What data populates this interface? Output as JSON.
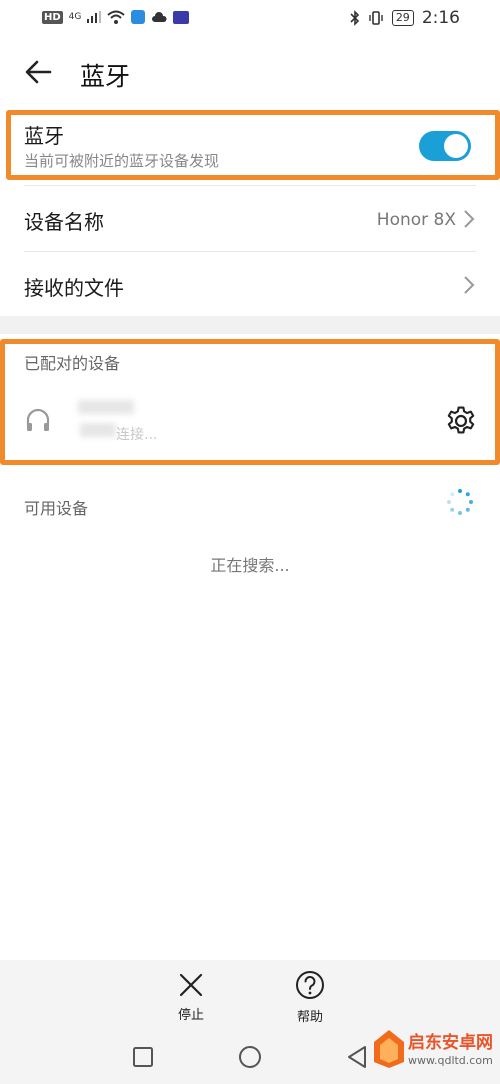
{
  "status_bar": {
    "hd": "HD",
    "network": "4G",
    "time": "2:16",
    "battery": "29"
  },
  "header": {
    "title": "蓝牙"
  },
  "bluetooth": {
    "label": "蓝牙",
    "subtitle": "当前可被附近的蓝牙设备发现",
    "enabled": true
  },
  "device_name": {
    "label": "设备名称",
    "value": "Honor 8X"
  },
  "received_files": {
    "label": "接收的文件"
  },
  "paired": {
    "title": "已配对的设备",
    "device_status": "连接..."
  },
  "available": {
    "title": "可用设备",
    "searching": "正在搜索..."
  },
  "bottom_bar": {
    "stop_label": "停止",
    "help_label": "帮助"
  },
  "colors": {
    "accent": "#1a9fd6",
    "highlight": "#f08a2b"
  },
  "watermark": {
    "site_cn": "启东安卓网",
    "site_url": "www.qdltd.com"
  }
}
